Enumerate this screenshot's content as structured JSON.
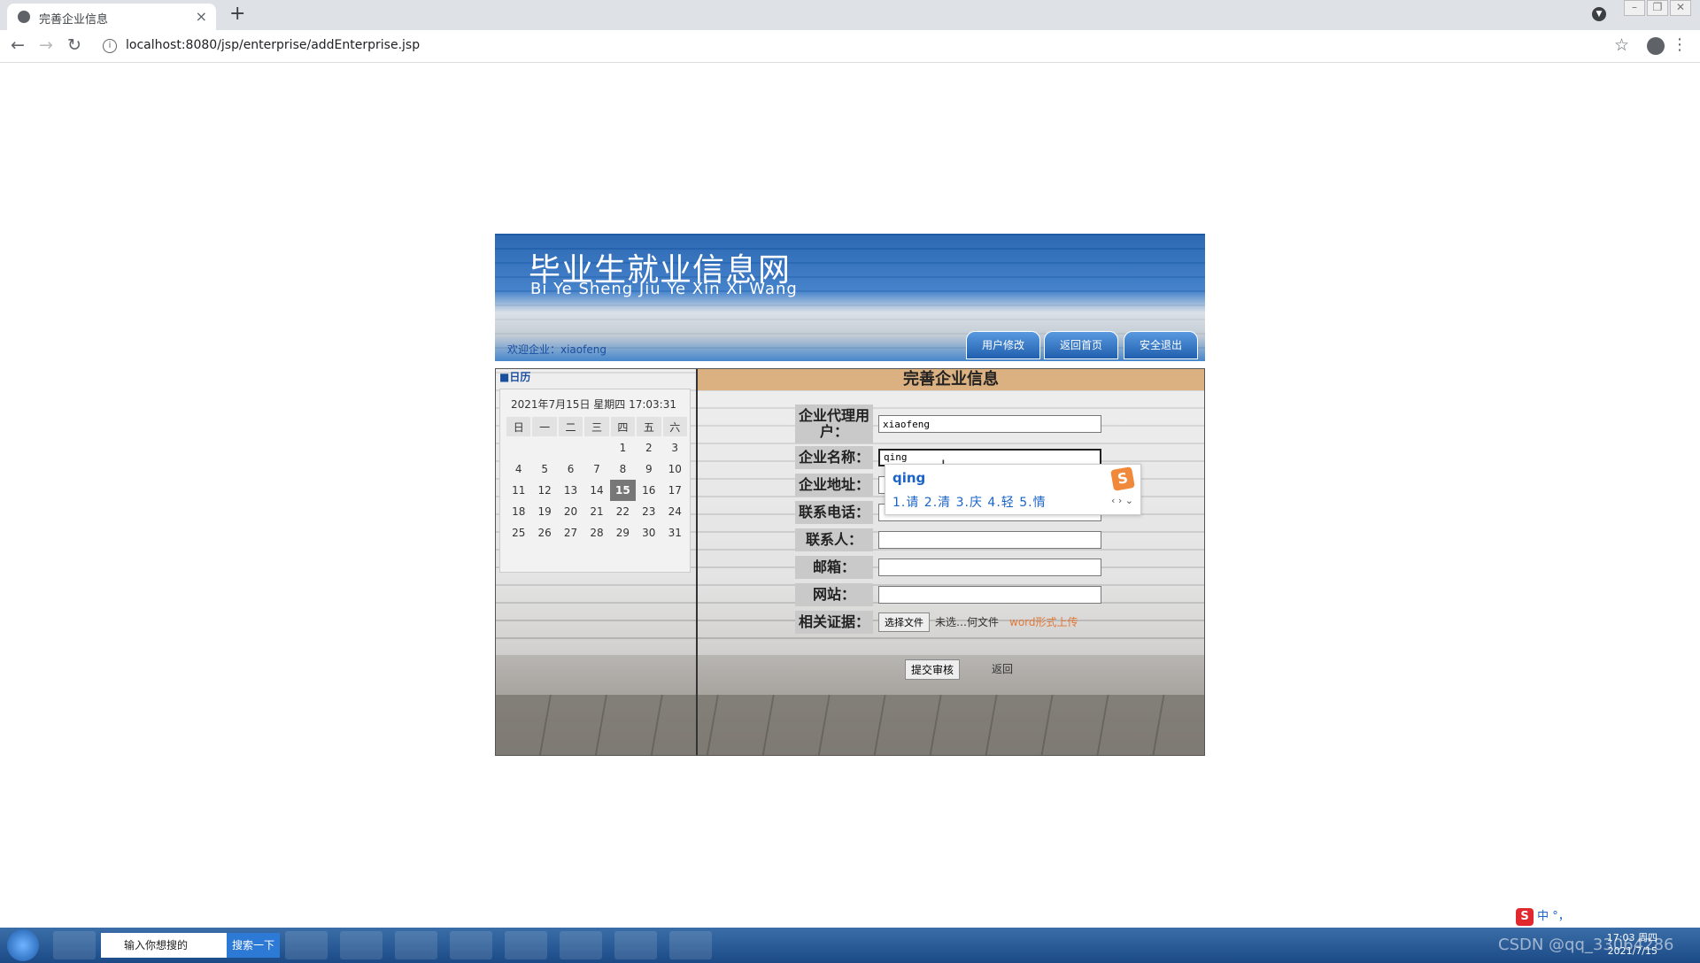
{
  "browser": {
    "tab_title": "完善企业信息",
    "url": "localhost:8080/jsp/enterprise/addEnterprise.jsp"
  },
  "site": {
    "title": "毕业生就业信息网",
    "subtitle": "Bi Ye Sheng Jiu Ye Xin Xi Wang",
    "welcome": "欢迎企业：xiaofeng",
    "nav": [
      "用户修改",
      "返回首页",
      "安全退出"
    ]
  },
  "calendar": {
    "heading": "■日历",
    "datetime": "2021年7月15日 星期四 17:03:31",
    "weekdays": [
      "日",
      "一",
      "二",
      "三",
      "四",
      "五",
      "六"
    ],
    "weeks": [
      [
        "",
        "",
        "",
        "",
        "1",
        "2",
        "3"
      ],
      [
        "4",
        "5",
        "6",
        "7",
        "8",
        "9",
        "10"
      ],
      [
        "11",
        "12",
        "13",
        "14",
        "15",
        "16",
        "17"
      ],
      [
        "18",
        "19",
        "20",
        "21",
        "22",
        "23",
        "24"
      ],
      [
        "25",
        "26",
        "27",
        "28",
        "29",
        "30",
        "31"
      ]
    ],
    "today": "15"
  },
  "form": {
    "title": "完善企业信息",
    "fields": [
      {
        "label": "企业代理用户：",
        "value": "xiaofeng"
      },
      {
        "label": "企业名称：",
        "value": "qing"
      },
      {
        "label": "企业地址：",
        "value": ""
      },
      {
        "label": "联系电话：",
        "value": ""
      },
      {
        "label": "联系人：",
        "value": ""
      },
      {
        "label": "邮箱：",
        "value": ""
      },
      {
        "label": "网站：",
        "value": ""
      }
    ],
    "file_label": "相关证据：",
    "file_button": "选择文件",
    "file_status": "未选…何文件",
    "file_note": "word形式上传",
    "submit": "提交审核",
    "back": "返回"
  },
  "ime": {
    "pinyin": "qing",
    "candidates": "1.请  2.清  3.庆  4.轻  5.情"
  },
  "taskbar": {
    "search_placeholder": "输入你想搜的",
    "search_button": "搜索一下",
    "ime_tray": "中 °，",
    "clock_time": "17:03 周四",
    "clock_date": "2021/7/15",
    "watermark": "CSDN @qq_33064286"
  }
}
